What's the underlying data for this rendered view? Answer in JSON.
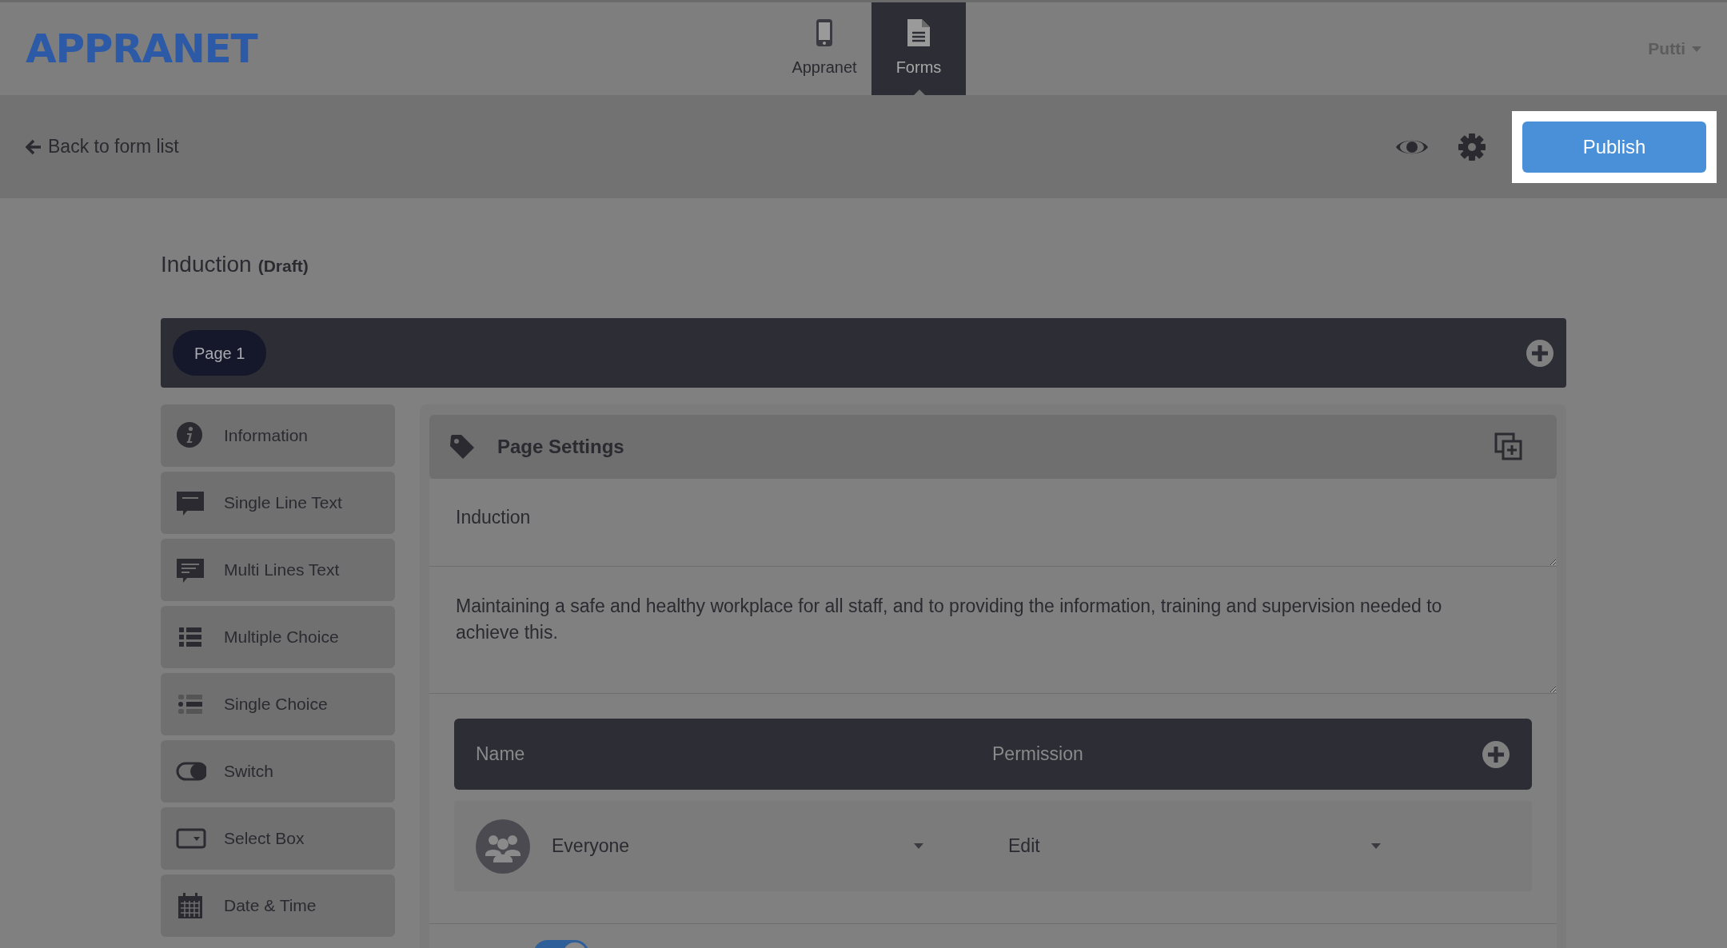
{
  "header": {
    "logo": "APPRANET",
    "tabs": [
      {
        "label": "Appranet",
        "kind": "phone",
        "selected": false
      },
      {
        "label": "Forms",
        "kind": "document",
        "selected": true
      }
    ],
    "user": "Putti"
  },
  "action_bar": {
    "back_link": "Back to form list",
    "publish_button": "Publish"
  },
  "form": {
    "title": "Induction",
    "status": "(Draft)"
  },
  "pages": [
    {
      "label": "Page 1",
      "selected": true
    }
  ],
  "sidebar": {
    "items": [
      {
        "label": "Information",
        "kind": "info"
      },
      {
        "label": "Single Line Text",
        "kind": "single-line"
      },
      {
        "label": "Multi Lines Text",
        "kind": "multi-line"
      },
      {
        "label": "Multiple Choice",
        "kind": "multiple"
      },
      {
        "label": "Single Choice",
        "kind": "single"
      },
      {
        "label": "Switch",
        "kind": "switch"
      },
      {
        "label": "Select Box",
        "kind": "select"
      },
      {
        "label": "Date & Time",
        "kind": "date"
      }
    ]
  },
  "page_settings": {
    "title": "Page Settings",
    "name_value": "Induction",
    "description_value": "Maintaining a safe and healthy workplace for all staff, and to providing the information, training and supervision needed to achieve this.",
    "permissions": {
      "columns": [
        "Name",
        "Permission"
      ],
      "rows": [
        {
          "name": "Everyone",
          "permission": "Edit"
        }
      ]
    },
    "bottom_switch": {
      "on": true
    }
  }
}
